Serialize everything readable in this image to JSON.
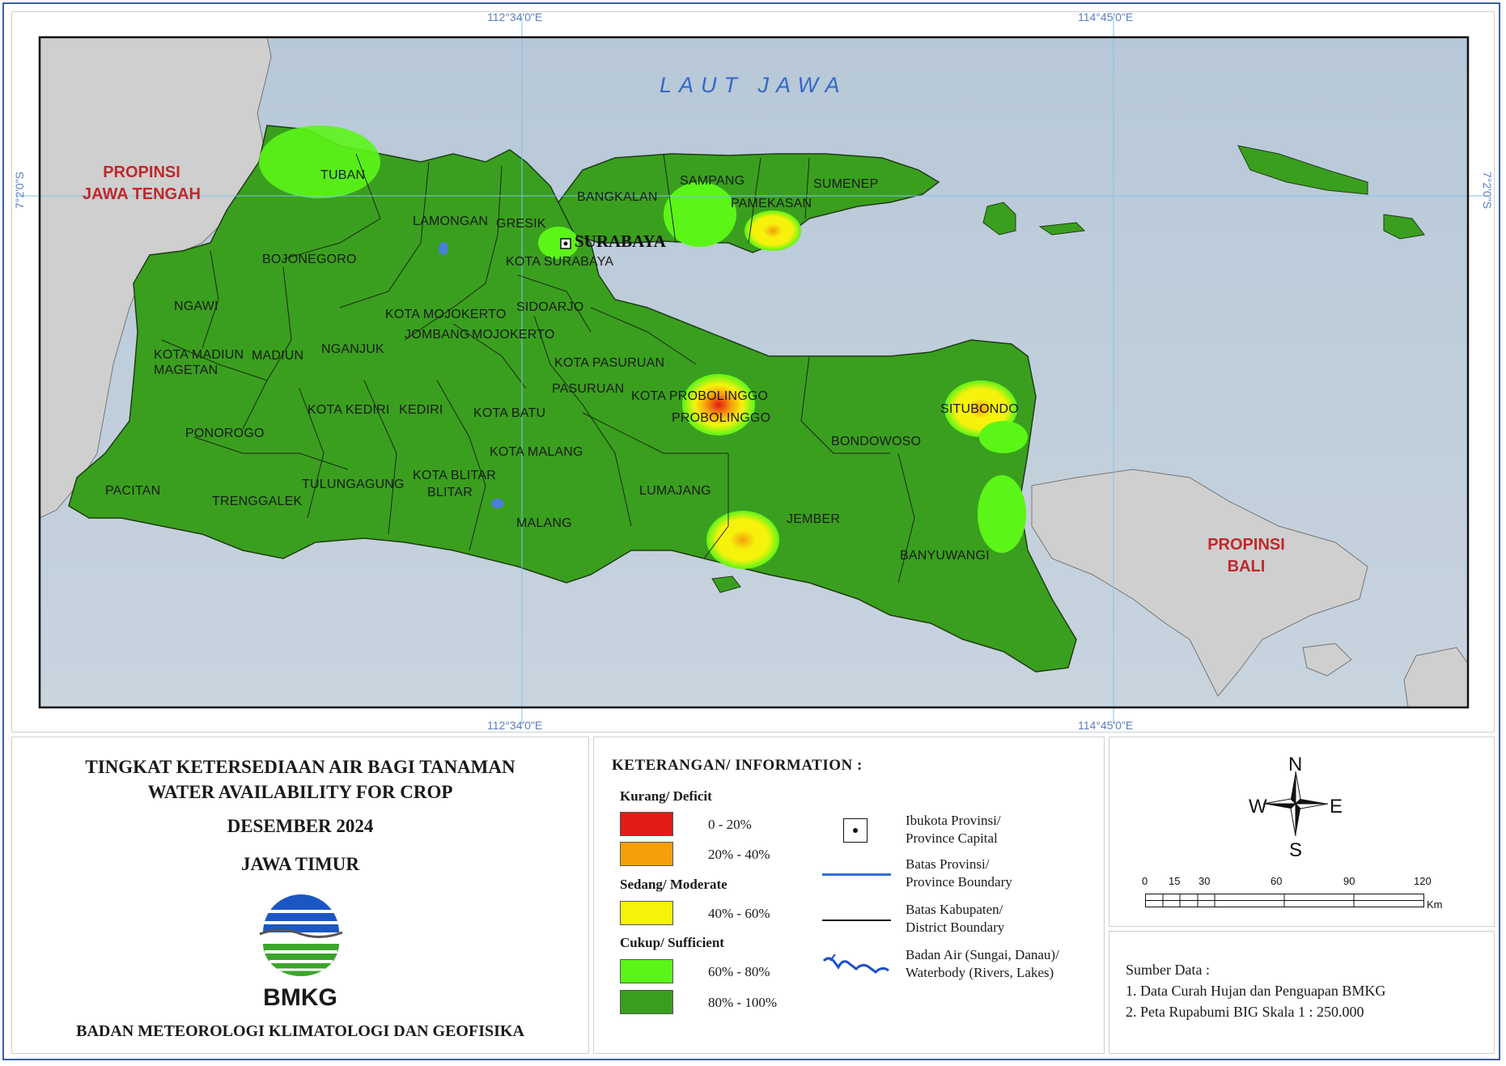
{
  "map": {
    "coords": {
      "top_left": "112°34'0\"E",
      "top_right": "114°45'0\"E",
      "bottom_left": "112°34'0\"E",
      "bottom_right": "114°45'0\"E",
      "left_lat": "7°2'0\"S",
      "right_lat": "7°2'0\"S"
    },
    "sea": "LAUT JAWA",
    "provinces": {
      "west": [
        "PROPINSI",
        "JAWA TENGAH"
      ],
      "east": [
        "PROPINSI",
        "BALI"
      ]
    },
    "capital": "SURABAYA",
    "regions": [
      "TUBAN",
      "LAMONGAN",
      "GRESIK",
      "BOJONEGORO",
      "KOTA SURABAYA",
      "NGAWI",
      "KOTA MOJOKERTO",
      "SIDOARJO",
      "JOMBANG",
      "MOJOKERTO",
      "KOTA MADIUN",
      "MADIUN",
      "NGANJUK",
      "MAGETAN",
      "KOTA PASURUAN",
      "PASURUAN",
      "KOTA PROBOLINGGO",
      "PROBOLINGGO",
      "KOTA KEDIRI",
      "KEDIRI",
      "KOTA BATU",
      "PONOROGO",
      "KOTA MALANG",
      "BONDOWOSO",
      "SITUBONDO",
      "KOTA BLITAR",
      "BLITAR",
      "TULUNGAGUNG",
      "PACITAN",
      "TRENGGALEK",
      "LUMAJANG",
      "MALANG",
      "JEMBER",
      "BANYUWANGI",
      "BANGKALAN",
      "SAMPANG",
      "PAMEKASAN",
      "SUMENEP"
    ]
  },
  "title_block": {
    "line1": "TINGKAT  KETERSEDIAAN AIR BAGI TANAMAN",
    "line2": "WATER AVAILABILITY FOR CROP",
    "period": "DESEMBER 2024",
    "region": "JAWA TIMUR",
    "logo_text": "BMKG",
    "agency": "BADAN METEOROLOGI KLIMATOLOGI DAN GEOFISIKA"
  },
  "legend": {
    "heading": "KETERANGAN/ INFORMATION :",
    "categories": [
      {
        "name": "Kurang/ Deficit",
        "classes": [
          {
            "label": "0 - 20%",
            "color": "#e21b14"
          },
          {
            "label": "20% - 40%",
            "color": "#f5a00b"
          }
        ]
      },
      {
        "name": "Sedang/ Moderate",
        "classes": [
          {
            "label": "40% - 60%",
            "color": "#f7f20c"
          }
        ]
      },
      {
        "name": "Cukup/ Sufficient",
        "classes": [
          {
            "label": "60% - 80%",
            "color": "#5cf518"
          },
          {
            "label": "80% - 100%",
            "color": "#3a9f1e"
          }
        ]
      }
    ],
    "symbols": [
      {
        "line1": "Ibukota Provinsi/",
        "line2": "Province Capital"
      },
      {
        "line1": "Batas Provinsi/",
        "line2": "Province Boundary"
      },
      {
        "line1": "Batas Kabupaten/",
        "line2": "District Boundary"
      },
      {
        "line1": "Badan Air (Sungai, Danau)/",
        "line2": "Waterbody (Rivers, Lakes)"
      }
    ]
  },
  "compass": {
    "n": "N",
    "s": "S",
    "e": "E",
    "w": "W"
  },
  "scale": {
    "ticks": [
      "0",
      "15",
      "30",
      "60",
      "90",
      "120"
    ],
    "unit": "Km"
  },
  "source": {
    "heading": "Sumber Data :",
    "items": [
      "1. Data Curah Hujan dan Penguapan BMKG",
      "2. Peta Rupabumi BIG Skala 1 : 250.000"
    ]
  }
}
